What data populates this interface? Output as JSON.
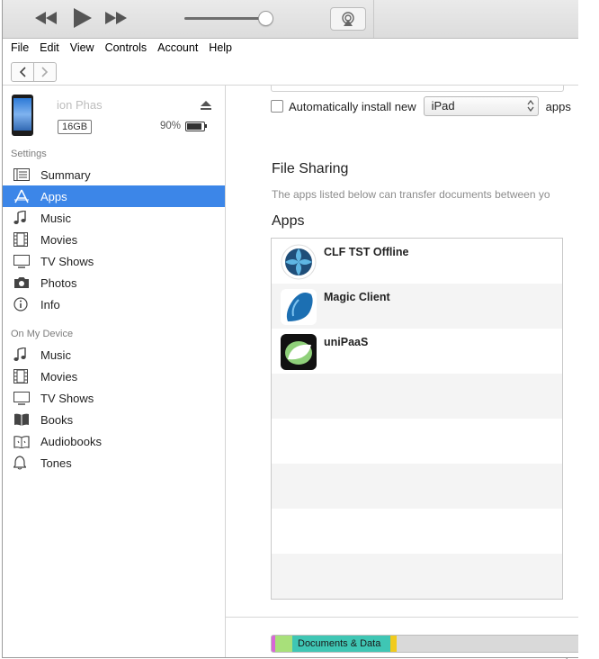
{
  "player": {
    "controls": [
      {
        "name": "rewind-button",
        "icon": "rewind-icon"
      },
      {
        "name": "play-button",
        "icon": "play-icon"
      },
      {
        "name": "fast-forward-button",
        "icon": "fast-forward-icon"
      }
    ],
    "volume_level": 0.9,
    "airplay_icon": "airplay-icon"
  },
  "menu": [
    "File",
    "Edit",
    "View",
    "Controls",
    "Account",
    "Help"
  ],
  "device": {
    "name": "ion Phas",
    "capacity": "16GB",
    "battery_text": "90%",
    "battery_level": 0.9
  },
  "sidebar": {
    "settings_heading": "Settings",
    "settings_items": [
      {
        "label": "Summary",
        "icon": "summary-icon",
        "selected": false
      },
      {
        "label": "Apps",
        "icon": "apps-icon",
        "selected": true
      },
      {
        "label": "Music",
        "icon": "music-note-icon",
        "selected": false
      },
      {
        "label": "Movies",
        "icon": "film-icon",
        "selected": false
      },
      {
        "label": "TV Shows",
        "icon": "tv-icon",
        "selected": false
      },
      {
        "label": "Photos",
        "icon": "camera-icon",
        "selected": false
      },
      {
        "label": "Info",
        "icon": "info-icon",
        "selected": false
      }
    ],
    "device_heading": "On My Device",
    "device_items": [
      {
        "label": "Music",
        "icon": "music-note-icon"
      },
      {
        "label": "Movies",
        "icon": "film-icon"
      },
      {
        "label": "TV Shows",
        "icon": "tv-icon"
      },
      {
        "label": "Books",
        "icon": "book-icon"
      },
      {
        "label": "Audiobooks",
        "icon": "audiobook-icon"
      },
      {
        "label": "Tones",
        "icon": "bell-icon"
      }
    ]
  },
  "main": {
    "auto_install_label": "Automatically install new",
    "auto_install_checked": false,
    "device_type_selected": "iPad",
    "auto_install_suffix": "apps",
    "file_sharing_title": "File Sharing",
    "file_sharing_desc": "The apps listed below can transfer documents between yo",
    "apps_title": "Apps",
    "apps": [
      {
        "name": "CLF TST Offline",
        "icon": "clf-app-icon"
      },
      {
        "name": "Magic Client",
        "icon": "magic-client-app-icon"
      },
      {
        "name": "uniPaaS",
        "icon": "unipaas-app-icon"
      }
    ],
    "storage_segments": [
      {
        "label": "",
        "color": "#d866d8",
        "fraction": 0.012
      },
      {
        "label": "",
        "color": "#a8e07a",
        "fraction": 0.055
      },
      {
        "label": "Documents & Data",
        "color": "#3fc6b4",
        "fraction": 0.32
      },
      {
        "label": "",
        "color": "#f1cb1e",
        "fraction": 0.02
      },
      {
        "label": "",
        "color": "#d9d9d9",
        "fraction": 0.593
      }
    ]
  },
  "colors": {
    "selection": "#3c86e8",
    "toolbar": "#e2e2e2"
  }
}
